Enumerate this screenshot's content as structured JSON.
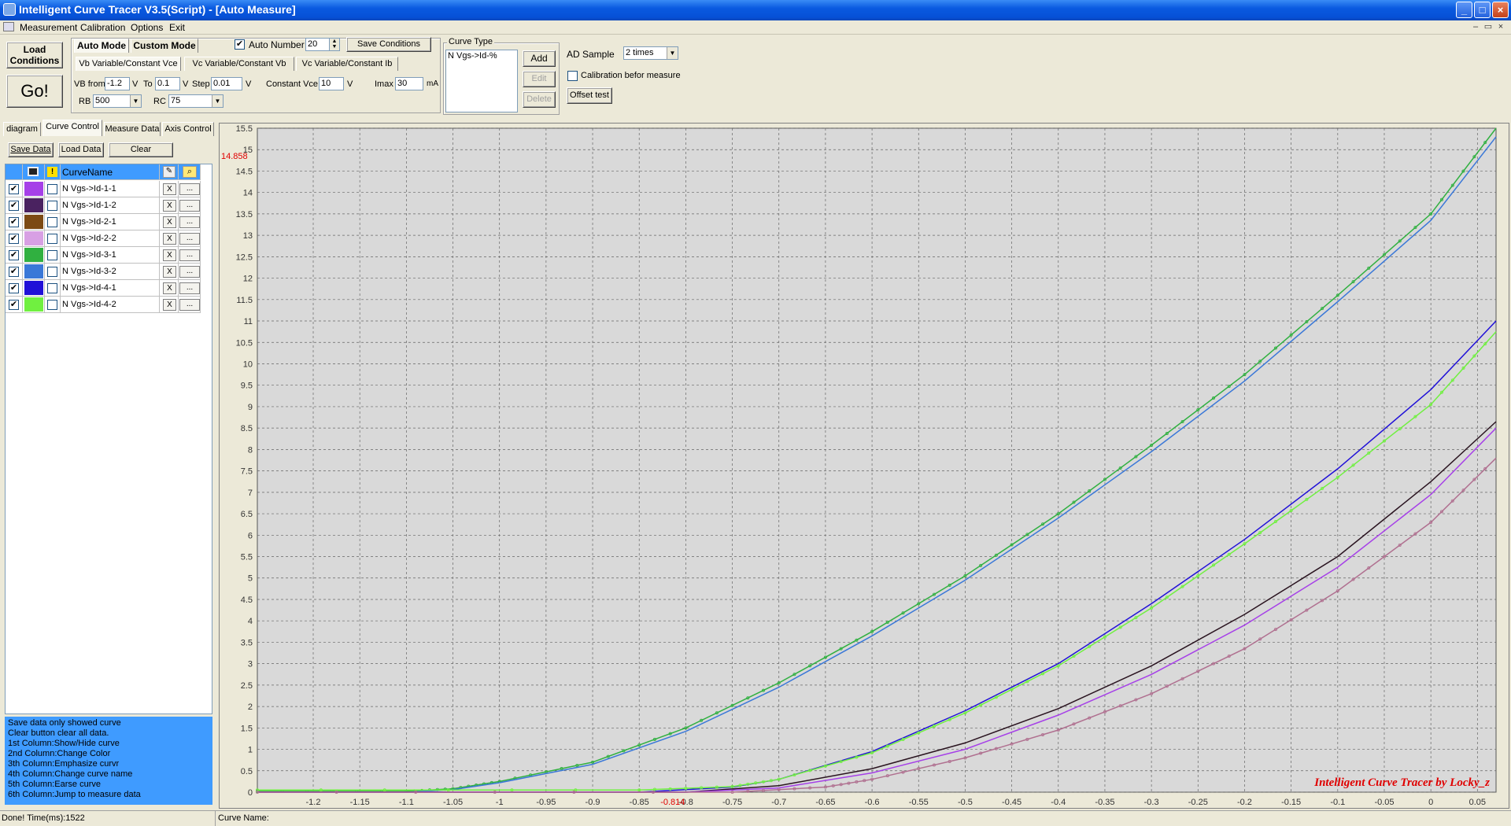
{
  "window": {
    "title": "Intelligent Curve Tracer V3.5(Script) - [Auto Measure]",
    "controls": [
      "_",
      "□",
      "×"
    ],
    "mdi_controls": [
      "–",
      "▭",
      "×"
    ]
  },
  "menu": [
    "Measurement",
    "Calibration",
    "Options",
    "Exit"
  ],
  "toolbar": {
    "load_conditions": "Load Conditions",
    "go": "Go!",
    "mode_tabs": [
      "Auto Mode",
      "Custom Mode"
    ],
    "sub_tabs": [
      "Vb Variable/Constant Vce",
      "Vc Variable/Constant Vb",
      "Vc Variable/Constant Ib"
    ],
    "auto_number_label": "Auto Number",
    "auto_number_checked": true,
    "auto_number_value": "20",
    "save_conditions": "Save Conditions",
    "vb_from_label": "VB from",
    "vb_from_value": "-1.2",
    "v_unit": "V",
    "to_label": "To",
    "to_value": "0.1",
    "step_label": "Step",
    "step_value": "0.01",
    "constant_vce_label": "Constant Vce",
    "constant_vce_value": "10",
    "imax_label": "Imax",
    "imax_value": "30",
    "imax_unit": "mA",
    "rb_label": "RB",
    "rb_value": "500",
    "rc_label": "RC",
    "rc_value": "75"
  },
  "curve_type": {
    "title": "Curve Type",
    "items": [
      "N Vgs->Id-%"
    ],
    "add": "Add",
    "edit": "Edit",
    "delete": "Delete"
  },
  "ad": {
    "label": "AD Sample",
    "value": "2 times",
    "calibration_label": "Calibration befor measure",
    "offset_test": "Offset test"
  },
  "side_tabs": [
    "diagram",
    "Curve Control",
    "Measure Data",
    "Axis Control"
  ],
  "side_buttons": {
    "save": "Save Data",
    "load": "Load Data",
    "clear": "Clear"
  },
  "curve_table": {
    "header": "CurveName",
    "x_label": "X",
    "more_label": "...",
    "rows": [
      {
        "name": "N Vgs->Id-1-1",
        "color": "#a640e8",
        "checked": true
      },
      {
        "name": "N Vgs->Id-1-2",
        "color": "#4a2260",
        "checked": true
      },
      {
        "name": "N Vgs->Id-2-1",
        "color": "#7c4a14",
        "checked": true
      },
      {
        "name": "N Vgs->Id-2-2",
        "color": "#d8a0e4",
        "checked": true
      },
      {
        "name": "N Vgs->Id-3-1",
        "color": "#30b040",
        "checked": true
      },
      {
        "name": "N Vgs->Id-3-2",
        "color": "#3a78d8",
        "checked": true
      },
      {
        "name": "N Vgs->Id-4-1",
        "color": "#2010d8",
        "checked": true
      },
      {
        "name": "N Vgs->Id-4-2",
        "color": "#70f040",
        "checked": true
      }
    ]
  },
  "help": [
    "  Save data only showed curve",
    "  Clear button clear all data.",
    "1st Column:Show/Hide curve",
    "2nd Column:Change Color",
    "3th Column:Emphasize curvr",
    "4th Column:Change curve name",
    "5th Column:Earse curve",
    "6th Column:Jump to measure data"
  ],
  "status": {
    "left": "Done!  Time(ms):1522",
    "right": "Curve Name:"
  },
  "chart_data": {
    "type": "line",
    "watermark": "Intelligent Curve Tracer by Locky_z",
    "cursor_y_label": "14.858",
    "cursor_x_label": "-0.814",
    "xlim": [
      -1.26,
      0.07
    ],
    "ylim": [
      0,
      15.5
    ],
    "x_ticks": [
      -1.2,
      -1.15,
      -1.1,
      -1.05,
      -1,
      -0.95,
      -0.9,
      -0.85,
      -0.8,
      -0.75,
      -0.7,
      -0.65,
      -0.6,
      -0.55,
      -0.5,
      -0.45,
      -0.4,
      -0.35,
      -0.3,
      -0.25,
      -0.2,
      -0.15,
      -0.1,
      -0.05,
      0,
      0.05
    ],
    "y_ticks": [
      0,
      0.5,
      1,
      1.5,
      2,
      2.5,
      3,
      3.5,
      4,
      4.5,
      5,
      5.5,
      6,
      6.5,
      7,
      7.5,
      8,
      8.5,
      9,
      9.5,
      10,
      10.5,
      11,
      11.5,
      12,
      12.5,
      13,
      13.5,
      14,
      14.5,
      15,
      15.5
    ],
    "grid": true,
    "series": [
      {
        "color": "#30b040",
        "markers": true,
        "x": [
          -1.26,
          -1.1,
          -1.05,
          -1.0,
          -0.9,
          -0.8,
          -0.7,
          -0.6,
          -0.5,
          -0.4,
          -0.3,
          -0.2,
          -0.1,
          0.0,
          0.07
        ],
        "y": [
          0.02,
          0.02,
          0.08,
          0.25,
          0.7,
          1.5,
          2.55,
          3.75,
          5.05,
          6.5,
          8.1,
          9.75,
          11.6,
          13.5,
          15.5
        ]
      },
      {
        "color": "#3a78d8",
        "markers": false,
        "x": [
          -1.26,
          -1.1,
          -1.05,
          -1.0,
          -0.9,
          -0.8,
          -0.7,
          -0.6,
          -0.5,
          -0.4,
          -0.3,
          -0.2,
          -0.1,
          0.0,
          0.07
        ],
        "y": [
          0.0,
          0.0,
          0.06,
          0.22,
          0.65,
          1.42,
          2.45,
          3.65,
          4.95,
          6.4,
          7.95,
          9.6,
          11.45,
          13.35,
          15.3
        ]
      },
      {
        "color": "#2010d8",
        "markers": false,
        "x": [
          -1.26,
          -0.85,
          -0.75,
          -0.7,
          -0.6,
          -0.5,
          -0.4,
          -0.3,
          -0.2,
          -0.1,
          0.0,
          0.07
        ],
        "y": [
          0.0,
          0.0,
          0.12,
          0.3,
          0.95,
          1.9,
          3.0,
          4.4,
          5.9,
          7.55,
          9.4,
          11.0
        ]
      },
      {
        "color": "#70f040",
        "markers": true,
        "x": [
          -1.26,
          -0.85,
          -0.75,
          -0.7,
          -0.6,
          -0.5,
          -0.4,
          -0.3,
          -0.2,
          -0.1,
          0.0,
          0.07
        ],
        "y": [
          0.05,
          0.05,
          0.13,
          0.3,
          0.92,
          1.85,
          2.95,
          4.3,
          5.8,
          7.35,
          9.05,
          10.75
        ]
      },
      {
        "color": "#2a1420",
        "markers": false,
        "x": [
          -1.26,
          -0.8,
          -0.7,
          -0.6,
          -0.5,
          -0.4,
          -0.3,
          -0.2,
          -0.1,
          0.0,
          0.07
        ],
        "y": [
          0.0,
          0.0,
          0.15,
          0.55,
          1.15,
          1.95,
          2.95,
          4.15,
          5.5,
          7.25,
          8.65
        ]
      },
      {
        "color": "#a640e8",
        "markers": false,
        "x": [
          -1.26,
          -0.8,
          -0.7,
          -0.6,
          -0.5,
          -0.4,
          -0.3,
          -0.2,
          -0.1,
          0.0,
          0.07
        ],
        "y": [
          0.0,
          0.0,
          0.1,
          0.45,
          1.0,
          1.8,
          2.75,
          3.9,
          5.25,
          6.95,
          8.5
        ]
      },
      {
        "color": "#b07090",
        "markers": true,
        "x": [
          -1.26,
          -0.75,
          -0.65,
          -0.6,
          -0.5,
          -0.4,
          -0.3,
          -0.2,
          -0.1,
          0.0,
          0.07
        ],
        "y": [
          0.0,
          0.0,
          0.12,
          0.3,
          0.8,
          1.45,
          2.3,
          3.35,
          4.7,
          6.3,
          7.8
        ]
      }
    ]
  }
}
